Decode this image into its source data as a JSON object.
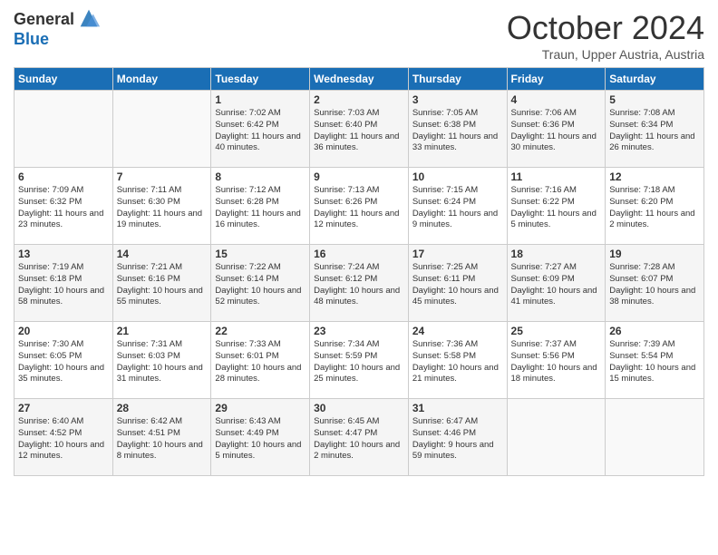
{
  "logo": {
    "general": "General",
    "blue": "Blue"
  },
  "title": "October 2024",
  "subtitle": "Traun, Upper Austria, Austria",
  "days_header": [
    "Sunday",
    "Monday",
    "Tuesday",
    "Wednesday",
    "Thursday",
    "Friday",
    "Saturday"
  ],
  "weeks": [
    [
      {
        "day": "",
        "info": ""
      },
      {
        "day": "",
        "info": ""
      },
      {
        "day": "1",
        "info": "Sunrise: 7:02 AM\nSunset: 6:42 PM\nDaylight: 11 hours and 40 minutes."
      },
      {
        "day": "2",
        "info": "Sunrise: 7:03 AM\nSunset: 6:40 PM\nDaylight: 11 hours and 36 minutes."
      },
      {
        "day": "3",
        "info": "Sunrise: 7:05 AM\nSunset: 6:38 PM\nDaylight: 11 hours and 33 minutes."
      },
      {
        "day": "4",
        "info": "Sunrise: 7:06 AM\nSunset: 6:36 PM\nDaylight: 11 hours and 30 minutes."
      },
      {
        "day": "5",
        "info": "Sunrise: 7:08 AM\nSunset: 6:34 PM\nDaylight: 11 hours and 26 minutes."
      }
    ],
    [
      {
        "day": "6",
        "info": "Sunrise: 7:09 AM\nSunset: 6:32 PM\nDaylight: 11 hours and 23 minutes."
      },
      {
        "day": "7",
        "info": "Sunrise: 7:11 AM\nSunset: 6:30 PM\nDaylight: 11 hours and 19 minutes."
      },
      {
        "day": "8",
        "info": "Sunrise: 7:12 AM\nSunset: 6:28 PM\nDaylight: 11 hours and 16 minutes."
      },
      {
        "day": "9",
        "info": "Sunrise: 7:13 AM\nSunset: 6:26 PM\nDaylight: 11 hours and 12 minutes."
      },
      {
        "day": "10",
        "info": "Sunrise: 7:15 AM\nSunset: 6:24 PM\nDaylight: 11 hours and 9 minutes."
      },
      {
        "day": "11",
        "info": "Sunrise: 7:16 AM\nSunset: 6:22 PM\nDaylight: 11 hours and 5 minutes."
      },
      {
        "day": "12",
        "info": "Sunrise: 7:18 AM\nSunset: 6:20 PM\nDaylight: 11 hours and 2 minutes."
      }
    ],
    [
      {
        "day": "13",
        "info": "Sunrise: 7:19 AM\nSunset: 6:18 PM\nDaylight: 10 hours and 58 minutes."
      },
      {
        "day": "14",
        "info": "Sunrise: 7:21 AM\nSunset: 6:16 PM\nDaylight: 10 hours and 55 minutes."
      },
      {
        "day": "15",
        "info": "Sunrise: 7:22 AM\nSunset: 6:14 PM\nDaylight: 10 hours and 52 minutes."
      },
      {
        "day": "16",
        "info": "Sunrise: 7:24 AM\nSunset: 6:12 PM\nDaylight: 10 hours and 48 minutes."
      },
      {
        "day": "17",
        "info": "Sunrise: 7:25 AM\nSunset: 6:11 PM\nDaylight: 10 hours and 45 minutes."
      },
      {
        "day": "18",
        "info": "Sunrise: 7:27 AM\nSunset: 6:09 PM\nDaylight: 10 hours and 41 minutes."
      },
      {
        "day": "19",
        "info": "Sunrise: 7:28 AM\nSunset: 6:07 PM\nDaylight: 10 hours and 38 minutes."
      }
    ],
    [
      {
        "day": "20",
        "info": "Sunrise: 7:30 AM\nSunset: 6:05 PM\nDaylight: 10 hours and 35 minutes."
      },
      {
        "day": "21",
        "info": "Sunrise: 7:31 AM\nSunset: 6:03 PM\nDaylight: 10 hours and 31 minutes."
      },
      {
        "day": "22",
        "info": "Sunrise: 7:33 AM\nSunset: 6:01 PM\nDaylight: 10 hours and 28 minutes."
      },
      {
        "day": "23",
        "info": "Sunrise: 7:34 AM\nSunset: 5:59 PM\nDaylight: 10 hours and 25 minutes."
      },
      {
        "day": "24",
        "info": "Sunrise: 7:36 AM\nSunset: 5:58 PM\nDaylight: 10 hours and 21 minutes."
      },
      {
        "day": "25",
        "info": "Sunrise: 7:37 AM\nSunset: 5:56 PM\nDaylight: 10 hours and 18 minutes."
      },
      {
        "day": "26",
        "info": "Sunrise: 7:39 AM\nSunset: 5:54 PM\nDaylight: 10 hours and 15 minutes."
      }
    ],
    [
      {
        "day": "27",
        "info": "Sunrise: 6:40 AM\nSunset: 4:52 PM\nDaylight: 10 hours and 12 minutes."
      },
      {
        "day": "28",
        "info": "Sunrise: 6:42 AM\nSunset: 4:51 PM\nDaylight: 10 hours and 8 minutes."
      },
      {
        "day": "29",
        "info": "Sunrise: 6:43 AM\nSunset: 4:49 PM\nDaylight: 10 hours and 5 minutes."
      },
      {
        "day": "30",
        "info": "Sunrise: 6:45 AM\nSunset: 4:47 PM\nDaylight: 10 hours and 2 minutes."
      },
      {
        "day": "31",
        "info": "Sunrise: 6:47 AM\nSunset: 4:46 PM\nDaylight: 9 hours and 59 minutes."
      },
      {
        "day": "",
        "info": ""
      },
      {
        "day": "",
        "info": ""
      }
    ]
  ]
}
